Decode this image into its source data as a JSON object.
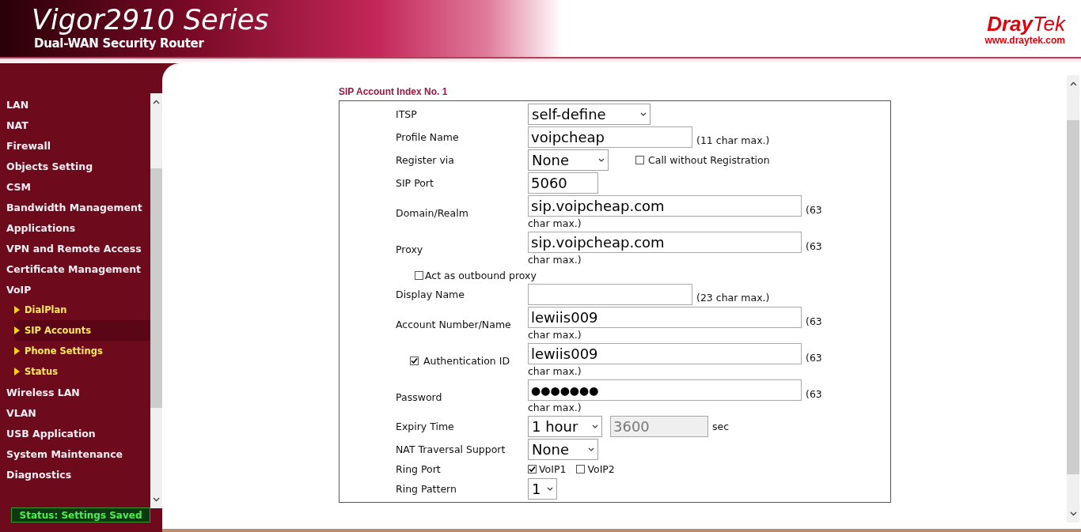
{
  "header": {
    "title": "Vigor2910 Series",
    "subtitle": "Dual-WAN Security Router",
    "logo": "**Dray**Tek",
    "url": "www.draytek.com"
  },
  "sidebar": {
    "items": [
      {
        "label": "LAN",
        "selected": false
      },
      {
        "label": "NAT",
        "selected": false
      },
      {
        "label": "Firewall",
        "selected": false
      },
      {
        "label": "Objects Setting",
        "selected": false
      },
      {
        "label": "CSM",
        "selected": false
      },
      {
        "label": "Bandwidth Management",
        "selected": false
      },
      {
        "label": "Applications",
        "selected": false
      },
      {
        "label": "VPN and Remote Access",
        "selected": false
      },
      {
        "label": "Certificate Management",
        "selected": false
      },
      {
        "label": "VoIP",
        "selected": false,
        "children": [
          {
            "label": "DialPlan",
            "selected": false
          },
          {
            "label": "SIP Accounts",
            "selected": true
          },
          {
            "label": "Phone Settings",
            "selected": false
          },
          {
            "label": "Status",
            "selected": false
          }
        ]
      },
      {
        "label": "Wireless LAN",
        "selected": false
      },
      {
        "label": "VLAN",
        "selected": false
      },
      {
        "label": "USB Application",
        "selected": false
      },
      {
        "label": "System Maintenance",
        "selected": false
      },
      {
        "label": "Diagnostics",
        "selected": false
      }
    ],
    "status": "Status: Settings Saved"
  },
  "form": {
    "title": "SIP Account Index No. 1",
    "rows": [
      {
        "kind": "select",
        "label": "ITSP",
        "value": "self-define"
      },
      {
        "kind": "text",
        "label": "Profile Name",
        "value": "voipcheap",
        "note": "(11 char max.)"
      },
      {
        "kind": "select",
        "label": "Register via",
        "value": "None",
        "option": {
          "label": "Call without Registration",
          "checked": false
        }
      },
      {
        "kind": "text",
        "label": "SIP Port",
        "value": "5060"
      },
      {
        "kind": "text",
        "label": "Domain/Realm",
        "value": "sip.voipcheap.com",
        "note_lines": [
          "(63",
          "char max.)"
        ]
      },
      {
        "kind": "text",
        "label": "Proxy",
        "value": "sip.voipcheap.com",
        "note_lines": [
          "(63",
          "char max.)"
        ]
      },
      {
        "kind": "checkbox",
        "label": "Act as outbound proxy",
        "checked": false
      },
      {
        "kind": "text",
        "label": "Display Name",
        "note": "(23 char max.)"
      },
      {
        "kind": "text",
        "label": "Account Number/Name",
        "value": "lewiis009",
        "note_lines": [
          "(63",
          "char max.)"
        ]
      },
      {
        "kind": "text",
        "label": "Authentication ID",
        "checked": true,
        "value": "lewiis009",
        "note_lines": [
          "(63",
          "char max.)"
        ]
      },
      {
        "kind": "text",
        "label": "Password",
        "value": "●●●●●●●",
        "note_lines": [
          "(63",
          "char max.)"
        ]
      },
      {
        "kind": "select",
        "label": "Expiry Time",
        "value": "1 hour",
        "seconds": {
          "value": "3600",
          "disabled": true
        },
        "unit": "sec"
      },
      {
        "kind": "select",
        "label": "NAT Traversal Support",
        "value": "None"
      },
      {
        "kind": "checks",
        "label": "Ring Port",
        "options": [
          {
            "label": "VoIP1",
            "checked": true
          },
          {
            "label": "VoIP2",
            "checked": false
          }
        ]
      },
      {
        "kind": "select",
        "label": "Ring Pattern",
        "value": "1"
      }
    ]
  }
}
